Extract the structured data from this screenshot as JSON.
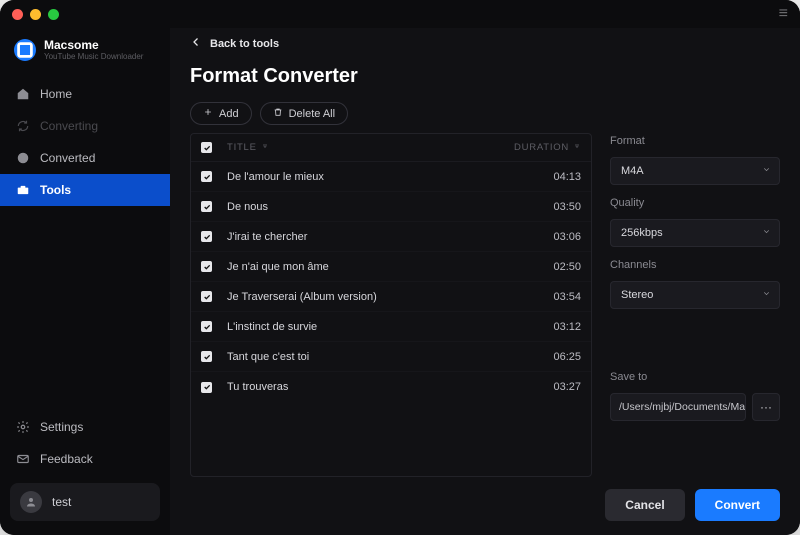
{
  "brand": {
    "name": "Macsome",
    "subtitle": "YouTube Music Downloader"
  },
  "sidebar": {
    "items": [
      {
        "label": "Home"
      },
      {
        "label": "Converting"
      },
      {
        "label": "Converted"
      },
      {
        "label": "Tools"
      }
    ],
    "bottom": [
      {
        "label": "Settings"
      },
      {
        "label": "Feedback"
      }
    ],
    "user": {
      "name": "test"
    }
  },
  "back_label": "Back to tools",
  "page_title": "Format Converter",
  "toolbar": {
    "add_label": "Add",
    "deleteall_label": "Delete All"
  },
  "table": {
    "headers": {
      "title": "TITLE",
      "duration": "DURATION"
    },
    "rows": [
      {
        "title": "De l'amour le mieux",
        "duration": "04:13"
      },
      {
        "title": "De nous",
        "duration": "03:50"
      },
      {
        "title": "J'irai te chercher",
        "duration": "03:06"
      },
      {
        "title": "Je n'ai que mon âme",
        "duration": "02:50"
      },
      {
        "title": "Je Traverserai (Album version)",
        "duration": "03:54"
      },
      {
        "title": "L'instinct de survie",
        "duration": "03:12"
      },
      {
        "title": "Tant que c'est toi",
        "duration": "06:25"
      },
      {
        "title": "Tu trouveras",
        "duration": "03:27"
      }
    ]
  },
  "form": {
    "format": {
      "label": "Format",
      "value": "M4A"
    },
    "quality": {
      "label": "Quality",
      "value": "256kbps"
    },
    "channels": {
      "label": "Channels",
      "value": "Stereo"
    },
    "saveto": {
      "label": "Save to",
      "value": "/Users/mjbj/Documents/Ma",
      "browse": "···"
    }
  },
  "buttons": {
    "cancel": "Cancel",
    "convert": "Convert"
  }
}
